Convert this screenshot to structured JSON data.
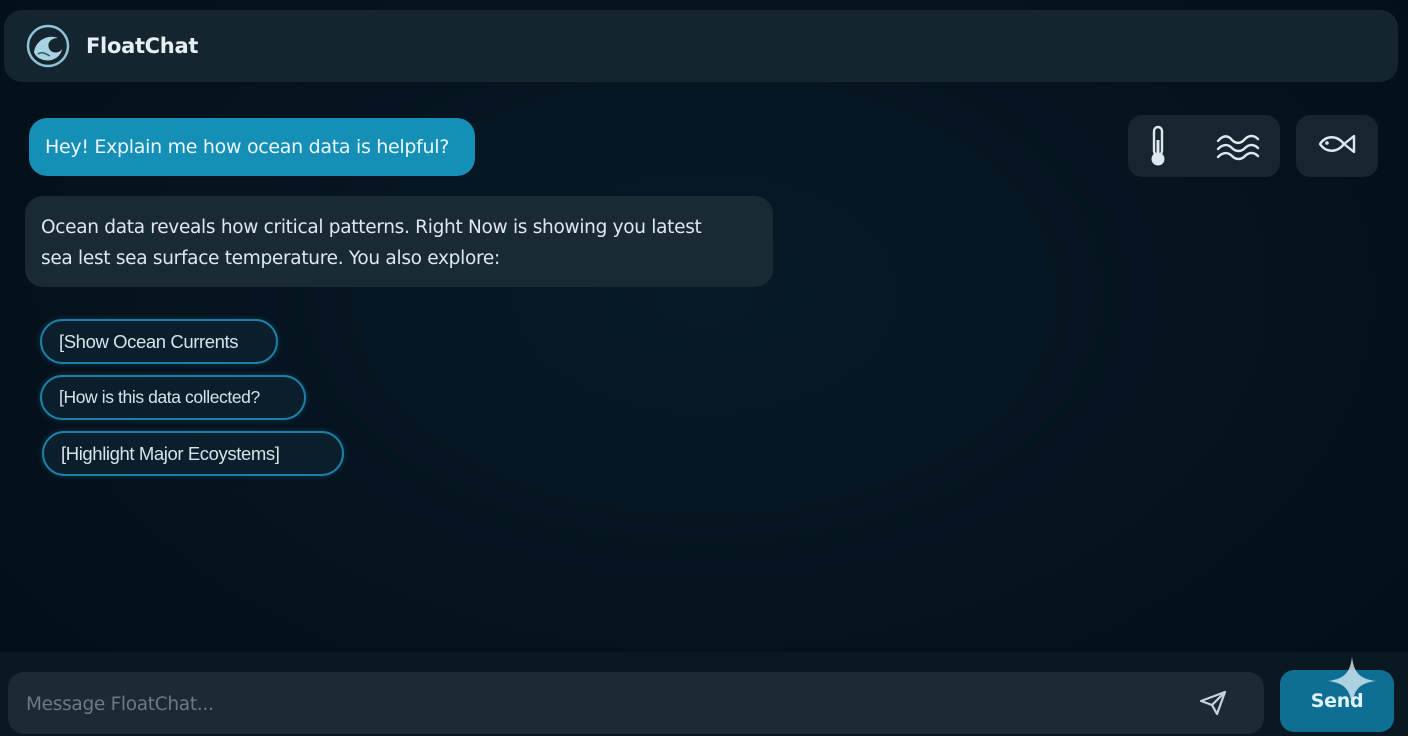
{
  "header": {
    "logo_icon": "wave-logo-icon",
    "title": "FloatChat"
  },
  "conversation": {
    "user_message": "Hey! Explain me how ocean data is helpful?",
    "bot_message": "Ocean data reveals how critical patterns. Right Now  is showing you latest\nsea lest  sea surface temperature. You also explore:"
  },
  "suggestions": [
    {
      "label": "[Show Ocean Currents"
    },
    {
      "label": "[How is this data collected?"
    },
    {
      "label": "[Highlight Major Ecoystems]"
    }
  ],
  "toolbar": {
    "icons": [
      "thermometer-icon",
      "waves-icon",
      "fish-icon"
    ]
  },
  "composer": {
    "placeholder": "Message FloatChat...",
    "value": "",
    "send_icon": "paper-plane-icon",
    "send_label": "Send"
  },
  "colors": {
    "accent": "#168fb6",
    "send_button": "#0f6e94",
    "background": "#051420",
    "panel": "#15252f"
  }
}
